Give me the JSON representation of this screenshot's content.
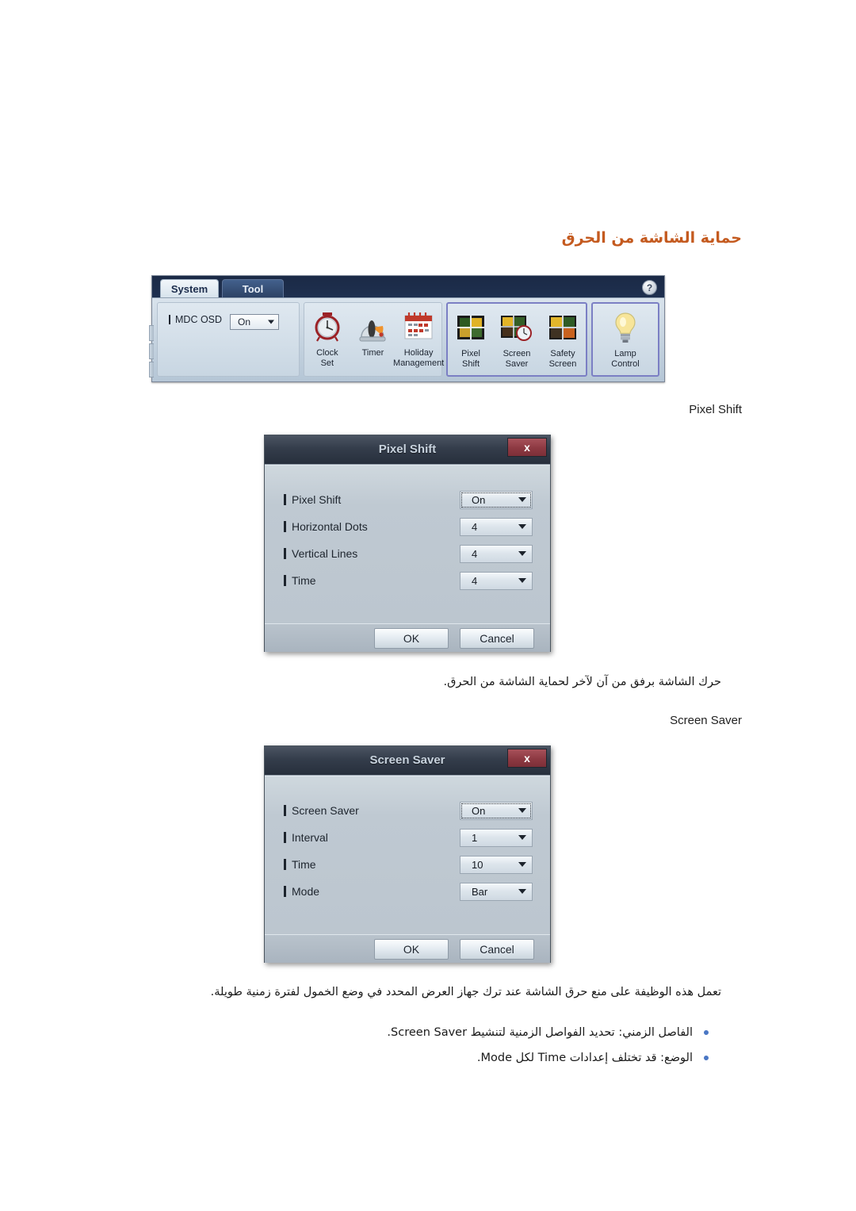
{
  "page": {
    "heading": "حماية الشاشة من الحرق"
  },
  "toolbar": {
    "tabs": [
      {
        "label": "System",
        "active": true
      },
      {
        "label": "Tool",
        "active": false
      }
    ],
    "help_label": "?",
    "osd": {
      "label": "MDC OSD",
      "value": "On"
    },
    "groups": [
      {
        "name": "time",
        "items": [
          {
            "icon": "clock-icon",
            "caption": "Clock\nSet"
          },
          {
            "icon": "timer-icon",
            "caption": "Timer"
          },
          {
            "icon": "calendar-icon",
            "caption": "Holiday\nManagement"
          }
        ]
      },
      {
        "name": "screen",
        "highlighted": true,
        "items": [
          {
            "icon": "pixel-shift-icon",
            "caption": "Pixel\nShift"
          },
          {
            "icon": "screen-saver-icon",
            "caption": "Screen\nSaver"
          },
          {
            "icon": "safety-screen-icon",
            "caption": "Safety\nScreen"
          }
        ]
      },
      {
        "name": "lamp",
        "highlighted": true,
        "items": [
          {
            "icon": "lightbulb-icon",
            "caption": "Lamp\nControl"
          }
        ]
      }
    ]
  },
  "sections": {
    "pixel_shift_label": "Pixel Shift",
    "screen_saver_label": "Screen Saver"
  },
  "pixel_shift_dialog": {
    "title": "Pixel Shift",
    "close_label": "x",
    "rows": [
      {
        "label": "Pixel Shift",
        "value": "On",
        "focused": true
      },
      {
        "label": "Horizontal Dots",
        "value": "4",
        "focused": false
      },
      {
        "label": "Vertical Lines",
        "value": "4",
        "focused": false
      },
      {
        "label": "Time",
        "value": "4",
        "focused": false
      }
    ],
    "ok_label": "OK",
    "cancel_label": "Cancel"
  },
  "screen_saver_dialog": {
    "title": "Screen Saver",
    "close_label": "x",
    "rows": [
      {
        "label": "Screen Saver",
        "value": "On",
        "focused": true
      },
      {
        "label": "Interval",
        "value": "1",
        "focused": false
      },
      {
        "label": "Time",
        "value": "10",
        "focused": false
      },
      {
        "label": "Mode",
        "value": "Bar",
        "focused": false
      }
    ],
    "ok_label": "OK",
    "cancel_label": "Cancel"
  },
  "body_text": {
    "pixel_shift_caption": "حرك الشاشة برفق من آن لآخر لحماية الشاشة من الحرق.",
    "screen_saver_caption": "تعمل هذه الوظيفة على منع حرق الشاشة عند ترك جهاز العرض المحدد في وضع الخمول لفترة زمنية طويلة.",
    "bullets": [
      "الفاصل الزمني:  تحديد الفواصل الزمنية لتنشيط Screen Saver.",
      "الوضع: قد تختلف إعدادات Time لكل Mode."
    ]
  },
  "colors": {
    "heading": "#c45a1f",
    "bullet": "#4a77c4",
    "highlight_border": "#7b7fc4",
    "close_button": "#8d3942"
  }
}
